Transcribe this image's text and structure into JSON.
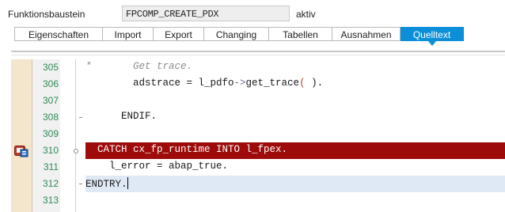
{
  "header": {
    "label": "Funktionsbaustein",
    "name": "FPCOMP_CREATE_PDX",
    "status": "aktiv"
  },
  "tabs": [
    {
      "label": "Eigenschaften",
      "active": false
    },
    {
      "label": "Import",
      "active": false
    },
    {
      "label": "Export",
      "active": false
    },
    {
      "label": "Changing",
      "active": false
    },
    {
      "label": "Tabellen",
      "active": false
    },
    {
      "label": "Ausnahmen",
      "active": false
    },
    {
      "label": "Quelltext",
      "active": true
    }
  ],
  "colors": {
    "active_tab": "#0a8fd8",
    "error_line": "#9e0b0b",
    "current_line": "#dfe8f5",
    "line_number": "#2e8b57",
    "gutter": "#f4e6cc"
  },
  "error_icon": "runtime-error-icon",
  "code_lines": [
    {
      "number": "305",
      "text": "*       Get trace."
    },
    {
      "number": "306",
      "text_parts": [
        "        adstrace = l_pdfo",
        "->",
        "get_trace",
        "(",
        " ).",
        ""
      ]
    },
    {
      "number": "307",
      "text": ""
    },
    {
      "number": "308",
      "text": "      ENDIF."
    },
    {
      "number": "309",
      "text": ""
    },
    {
      "number": "310",
      "text": "  CATCH cx_fp_runtime INTO l_fpex."
    },
    {
      "number": "311",
      "text": "    l_error = abap_true."
    },
    {
      "number": "312",
      "text": "ENDTRY."
    },
    {
      "number": "313",
      "text": ""
    }
  ]
}
